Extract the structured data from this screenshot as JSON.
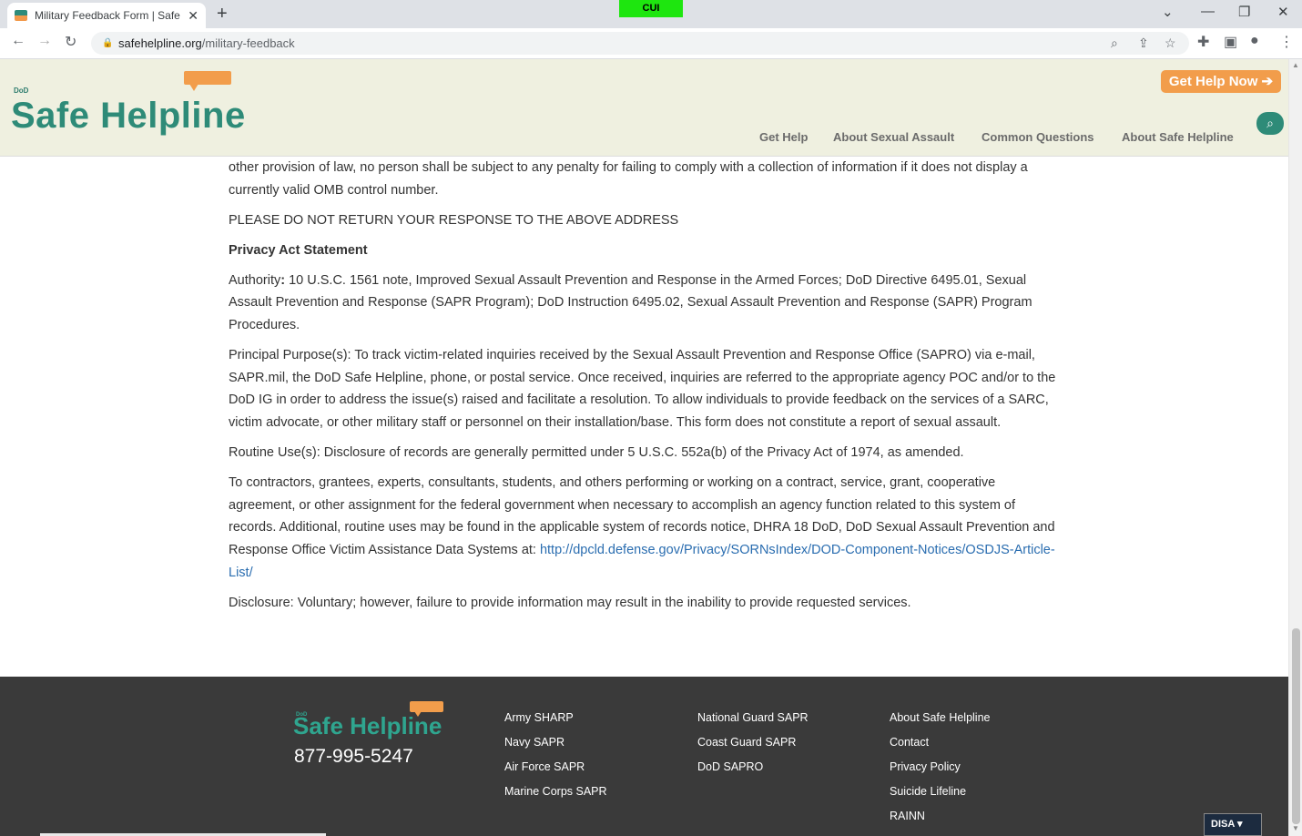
{
  "browser": {
    "tab_title": "Military Feedback Form | Safe he",
    "url_host": "safehelpline.org",
    "url_path": "/military-feedback",
    "cui_badge": "CUI"
  },
  "header": {
    "logo_dod": "DoD",
    "logo_name": "Safe Helpline",
    "cta_label": "Get  Help Now ➔",
    "nav": [
      "Get Help",
      "About Sexual Assault",
      "Common Questions",
      "About Safe Helpline"
    ]
  },
  "content": {
    "cut_line": "Notwithstanding any other provision of law, no person shall be subject to any penalty for failing to comply with a collection of information if it does not",
    "p1": "other provision of law, no person shall be subject to any penalty for failing to comply with a collection of information if it does not display a currently valid OMB control number.",
    "p2": "PLEASE DO NOT RETURN YOUR RESPONSE TO THE ABOVE ADDRESS",
    "heading": "Privacy Act Statement",
    "authority_label": "Authority",
    "authority_text": " 10 U.S.C. 1561 note, Improved Sexual Assault Prevention and Response in the Armed Forces;  DoD Directive 6495.01, Sexual Assault Prevention and Response (SAPR Program); DoD Instruction 6495.02, Sexual Assault Prevention and Response (SAPR) Program Procedures.",
    "purpose": "Principal Purpose(s): To track victim-related inquiries received by the Sexual Assault Prevention and Response Office (SAPRO) via e-mail, SAPR.mil, the DoD Safe Helpline, phone, or postal service.  Once received, inquiries are referred to the appropriate agency POC and/or to the DoD IG in order to address the issue(s) raised and facilitate a resolution.  To allow individuals to provide feedback on the services of a SARC, victim advocate, or other military staff or personnel on their installation/base. This form does not constitute a report of sexual assault.",
    "routine": "Routine Use(s): Disclosure of records are generally permitted under 5 U.S.C. 552a(b) of the Privacy Act of 1974, as amended.",
    "contractors": "To contractors, grantees, experts, consultants, students, and others performing or working on a contract, service, grant, cooperative agreement, or other assignment for the federal government when necessary to accomplish an agency function related to this system of records. Additional, routine uses may be found in the applicable system of records notice, DHRA 18 DoD, DoD Sexual Assault Prevention and Response Office Victim Assistance Data Systems at: ",
    "link": "http://dpcld.defense.gov/Privacy/SORNsIndex/DOD-Component-Notices/OSDJS-Article-List/",
    "disclosure": "Disclosure: Voluntary; however, failure to provide information may result in the inability to provide requested services."
  },
  "footer": {
    "logo_dod": "DoD",
    "logo_name": "Safe Helpline",
    "phone": "877-995-5247",
    "col1": [
      "Army SHARP",
      "Navy SAPR",
      "Air Force SAPR",
      "Marine Corps SAPR"
    ],
    "col2": [
      "National Guard SAPR",
      "Coast Guard SAPR",
      "DoD SAPRO"
    ],
    "col3": [
      "About Safe Helpline",
      "Contact",
      "Privacy Policy",
      "Suicide Lifeline",
      "RAINN"
    ],
    "disa": "DISA"
  },
  "colors": {
    "brand_green": "#2e8b78",
    "brand_orange": "#f29d4b",
    "footer_bg": "#3a3a3a",
    "link": "#2a6db0"
  }
}
